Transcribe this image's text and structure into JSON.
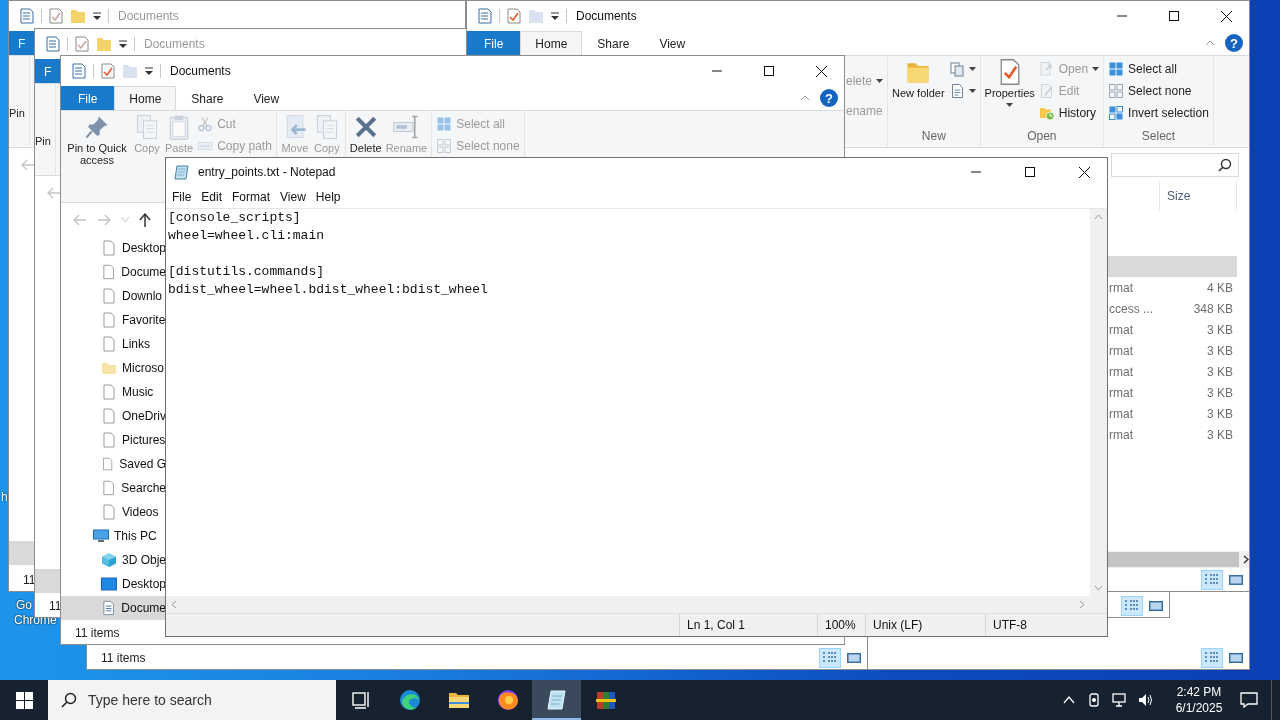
{
  "desktop": {
    "labels": [
      "h",
      "Go",
      "Chrome"
    ]
  },
  "explorer_windows": [
    {
      "title": "Documents",
      "active": false,
      "tabs": [
        {
          "label": "F",
          "kind": "file",
          "selected": false
        }
      ],
      "ribbon_groups": [
        {
          "items": [
            {
              "kind": "text",
              "label": "Pin",
              "big": true,
              "disabled": false,
              "dropdown": false
            }
          ]
        }
      ],
      "nav_buttons": [
        {
          "kind": "back",
          "disabled": true
        }
      ],
      "nav_selection_visible": true,
      "status": "11"
    },
    {
      "title": "Documents",
      "active": true,
      "window_controls": true,
      "help": "?",
      "tabs": [
        {
          "label": "File",
          "kind": "file",
          "selected": false
        },
        {
          "label": "Home",
          "kind": "tab",
          "selected": true
        },
        {
          "label": "Share",
          "kind": "tab",
          "selected": false
        },
        {
          "label": "View",
          "kind": "tab",
          "selected": false
        }
      ],
      "ribbon_groups": [
        {
          "items": [
            {
              "kind": "text",
              "label": "elete",
              "big": false,
              "disabled": true,
              "dropdown": true
            },
            {
              "kind": "text",
              "label": "ename",
              "big": false,
              "disabled": true,
              "dropdown": false
            }
          ]
        },
        {
          "label": "New",
          "items": [
            {
              "kind": "new-folder",
              "label": "New folder",
              "big": true,
              "disabled": false,
              "dropdown": false
            },
            {
              "kind": "new-item",
              "big": false,
              "disabled": false,
              "dropdown": true
            },
            {
              "kind": "easy-access",
              "big": false,
              "disabled": false,
              "dropdown": true
            }
          ]
        },
        {
          "label": "Open",
          "items": [
            {
              "kind": "properties",
              "label": "Properties",
              "big": true,
              "disabled": false,
              "dropdown": true
            },
            {
              "kind": "open",
              "label": "Open",
              "big": false,
              "disabled": true,
              "dropdown": true
            },
            {
              "kind": "edit",
              "label": "Edit",
              "big": false,
              "disabled": true,
              "dropdown": false
            },
            {
              "kind": "history",
              "label": "History",
              "big": false,
              "disabled": false,
              "dropdown": false
            }
          ]
        },
        {
          "label": "Select",
          "items": [
            {
              "kind": "select-all",
              "label": "Select all",
              "big": false,
              "disabled": false,
              "dropdown": false
            },
            {
              "kind": "select-none",
              "label": "Select none",
              "big": false,
              "disabled": false,
              "dropdown": false
            },
            {
              "kind": "invert",
              "label": "Invert selection",
              "big": false,
              "disabled": false,
              "dropdown": false
            }
          ]
        }
      ],
      "has_search": true,
      "columns": [
        {
          "label": "Size"
        }
      ],
      "rows": [
        {
          "selected": true
        },
        {
          "type": "rmat",
          "size": "4 KB",
          "selected": false
        },
        {
          "type": "ccess ...",
          "size": "348 KB",
          "selected": false
        },
        {
          "type": "rmat",
          "size": "3 KB",
          "selected": false
        },
        {
          "type": "rmat",
          "size": "3 KB",
          "selected": false
        },
        {
          "type": "rmat",
          "size": "3 KB",
          "selected": false
        },
        {
          "type": "rmat",
          "size": "3 KB",
          "selected": false
        },
        {
          "type": "rmat",
          "size": "3 KB",
          "selected": false
        },
        {
          "type": "rmat",
          "size": "3 KB",
          "selected": false
        }
      ],
      "horizontal_scrollbar": true,
      "view_buttons": [
        {
          "kind": "details",
          "selected": true
        },
        {
          "kind": "large-icons",
          "selected": false
        }
      ]
    },
    {
      "title": "Documents",
      "active": false,
      "tabs": [
        {
          "label": "F",
          "kind": "file",
          "selected": false
        }
      ],
      "ribbon_groups": [
        {
          "items": [
            {
              "kind": "text",
              "label": "Pin",
              "big": true,
              "disabled": false,
              "dropdown": false
            }
          ]
        }
      ],
      "nav_buttons": [
        {
          "kind": "back",
          "disabled": true
        }
      ],
      "nav_selection_visible": true,
      "status": "11",
      "view_buttons": [
        {
          "kind": "details",
          "selected": true
        },
        {
          "kind": "large-icons",
          "selected": false
        }
      ]
    },
    {
      "title": "Documents",
      "active": true,
      "window_controls": true,
      "help": "?",
      "tabs": [
        {
          "label": "File",
          "kind": "file",
          "selected": false
        },
        {
          "label": "Home",
          "kind": "tab",
          "selected": true
        },
        {
          "label": "Share",
          "kind": "tab",
          "selected": false
        },
        {
          "label": "View",
          "kind": "tab",
          "selected": false
        }
      ],
      "ribbon_groups": [
        {
          "items": [
            {
              "kind": "pin",
              "label": "Pin to Quick access",
              "big": true,
              "disabled": false,
              "dropdown": false
            },
            {
              "kind": "copy",
              "label": "Copy",
              "big": true,
              "disabled": true,
              "dropdown": false
            },
            {
              "kind": "paste",
              "label": "Paste",
              "big": true,
              "disabled": true,
              "dropdown": false
            },
            {
              "kind": "cut",
              "label": "Cut",
              "big": false,
              "disabled": true,
              "dropdown": false
            },
            {
              "kind": "copy-path",
              "label": "Copy path",
              "big": false,
              "disabled": true,
              "dropdown": false
            }
          ]
        },
        {
          "items": [
            {
              "kind": "move",
              "label": "Move",
              "big": true,
              "disabled": true,
              "dropdown": false
            },
            {
              "kind": "copy",
              "label": "Copy",
              "big": true,
              "disabled": true,
              "dropdown": false
            }
          ]
        },
        {
          "items": [
            {
              "kind": "delete",
              "label": "Delete",
              "big": true,
              "disabled": false,
              "dropdown": false
            },
            {
              "kind": "rename",
              "label": "Rename",
              "big": true,
              "disabled": true,
              "dropdown": false
            }
          ]
        },
        {
          "items": [
            {
              "kind": "select-all",
              "label": "Select all",
              "big": false,
              "disabled": true,
              "dropdown": false
            },
            {
              "kind": "select-none",
              "label": "Select none",
              "big": false,
              "disabled": true,
              "dropdown": false
            }
          ]
        }
      ],
      "nav_buttons": [
        {
          "kind": "back",
          "disabled": true
        },
        {
          "kind": "forward",
          "disabled": true
        },
        {
          "kind": "recent",
          "disabled": true
        },
        {
          "kind": "up",
          "disabled": false
        }
      ],
      "nav_tree": [
        {
          "label": "Desktop",
          "kind": "page",
          "selected": false
        },
        {
          "label": "Docume",
          "kind": "page",
          "selected": false
        },
        {
          "label": "Downlo",
          "kind": "page",
          "selected": false
        },
        {
          "label": "Favorite",
          "kind": "page",
          "selected": false
        },
        {
          "label": "Links",
          "kind": "page",
          "selected": false
        },
        {
          "label": "Microso",
          "kind": "folder",
          "selected": false
        },
        {
          "label": "Music",
          "kind": "page",
          "selected": false
        },
        {
          "label": "OneDriv",
          "kind": "page",
          "selected": false
        },
        {
          "label": "Pictures",
          "kind": "page",
          "selected": false
        },
        {
          "label": "Saved G",
          "kind": "page",
          "selected": false
        },
        {
          "label": "Searche",
          "kind": "page",
          "selected": false
        },
        {
          "label": "Videos",
          "kind": "page",
          "selected": false
        },
        {
          "label": "This PC",
          "kind": "pc",
          "selected": false,
          "children": [
            {
              "label": "3D Obje",
              "kind": "cube",
              "selected": false
            },
            {
              "label": "Desktop",
              "kind": "desktop",
              "selected": false
            },
            {
              "label": "Docume",
              "kind": "document",
              "selected": true
            }
          ]
        }
      ],
      "status": "11 items"
    },
    {
      "status": "11 items",
      "view_buttons": [
        {
          "kind": "details",
          "selected": true
        },
        {
          "kind": "large-icons",
          "selected": false
        }
      ]
    },
    {
      "view_buttons": [
        {
          "kind": "details",
          "selected": true
        },
        {
          "kind": "large-icons",
          "selected": false
        }
      ]
    }
  ],
  "notepad": {
    "title": "entry_points.txt - Notepad",
    "menu": [
      "File",
      "Edit",
      "Format",
      "View",
      "Help"
    ],
    "text": "[console_scripts]\nwheel=wheel.cli:main\n\n[distutils.commands]\nbdist_wheel=wheel.bdist_wheel:bdist_wheel",
    "status": [
      "Ln 1, Col 1",
      "100%",
      "Unix (LF)",
      "UTF-8"
    ]
  },
  "taskbar": {
    "search_placeholder": "Type here to search",
    "apps": [
      {
        "kind": "task-view",
        "active": false
      },
      {
        "kind": "swirl",
        "active": false
      },
      {
        "kind": "folder",
        "active": false
      },
      {
        "kind": "fox",
        "active": false
      },
      {
        "kind": "notepad",
        "active": true
      },
      {
        "kind": "books",
        "active": false
      }
    ],
    "clock": {
      "time": "2:42 PM",
      "date": "6/1/2025"
    }
  }
}
